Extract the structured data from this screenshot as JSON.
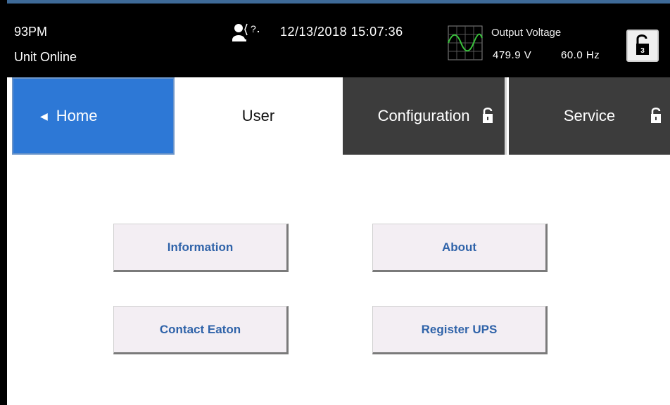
{
  "status_bar": {
    "model": "93PM",
    "unit_status": "Unit Online",
    "datetime": "12/13/2018 15:07:36",
    "output_voltage_label": "Output Voltage",
    "voltage": "479.9 V",
    "frequency": "60.0 Hz",
    "lock_level": "3",
    "icons": {
      "operator": "operator-help-icon",
      "waveform": "sine-waveform-icon",
      "lock": "unlocked-padlock-icon"
    }
  },
  "tabs": [
    {
      "label": "Home",
      "state": "navigable",
      "icon": "left-arrow-icon"
    },
    {
      "label": "User",
      "state": "active"
    },
    {
      "label": "Configuration",
      "state": "unlocked",
      "icon": "unlocked-padlock-icon"
    },
    {
      "label": "Service",
      "state": "unlocked",
      "icon": "unlocked-padlock-icon"
    }
  ],
  "menu": {
    "buttons": [
      {
        "label": "Information"
      },
      {
        "label": "About"
      },
      {
        "label": "Contact Eaton"
      },
      {
        "label": "Register UPS"
      }
    ]
  },
  "colors": {
    "status_bar_bg": "#000000",
    "home_tab_bg": "#2d78d6",
    "locked_tab_bg": "#3c3c3c",
    "button_text": "#2f63a9",
    "button_bg": "#f3eef3"
  }
}
